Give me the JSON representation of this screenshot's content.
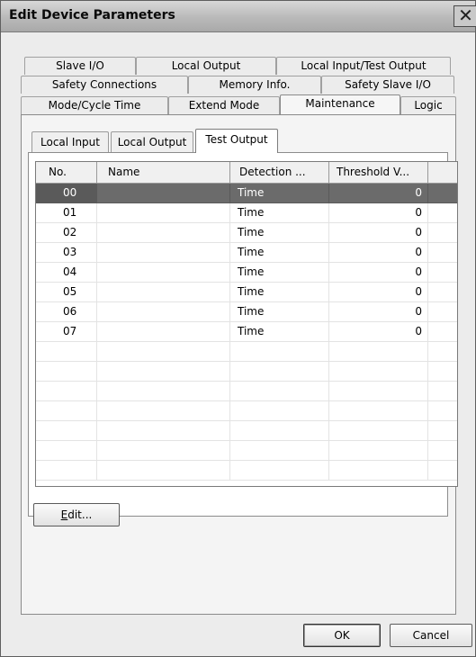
{
  "window": {
    "title": "Edit Device Parameters",
    "close_glyph": "✕"
  },
  "tabs": {
    "row1": [
      "Slave I/O",
      "Local Output",
      "Local Input/Test Output"
    ],
    "row2": [
      "Safety Connections",
      "Memory Info.",
      "Safety Slave I/O"
    ],
    "row3": [
      "Mode/Cycle Time",
      "Extend Mode",
      "Maintenance",
      "Logic"
    ],
    "selected": "Maintenance"
  },
  "subtabs": {
    "items": [
      "Local Input",
      "Local Output",
      "Test Output"
    ],
    "selected": "Test Output"
  },
  "table": {
    "columns": [
      "No.",
      "Name",
      "Detection ...",
      "Threshold V..."
    ],
    "rows": [
      {
        "no": "00",
        "name": "",
        "detection": "Time",
        "threshold": "0",
        "selected": true
      },
      {
        "no": "01",
        "name": "",
        "detection": "Time",
        "threshold": "0"
      },
      {
        "no": "02",
        "name": "",
        "detection": "Time",
        "threshold": "0"
      },
      {
        "no": "03",
        "name": "",
        "detection": "Time",
        "threshold": "0"
      },
      {
        "no": "04",
        "name": "",
        "detection": "Time",
        "threshold": "0"
      },
      {
        "no": "05",
        "name": "",
        "detection": "Time",
        "threshold": "0"
      },
      {
        "no": "06",
        "name": "",
        "detection": "Time",
        "threshold": "0"
      },
      {
        "no": "07",
        "name": "",
        "detection": "Time",
        "threshold": "0"
      }
    ]
  },
  "buttons": {
    "edit_mnemonic": "E",
    "edit_rest": "dit...",
    "ok": "OK",
    "cancel": "Cancel"
  }
}
